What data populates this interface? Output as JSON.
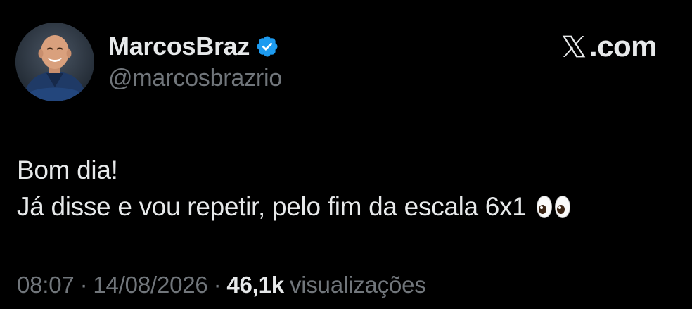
{
  "author": {
    "display_name": "MarcosBraz",
    "handle": "@marcosbrazrio",
    "verified": true,
    "verified_color": "#1d9bf0",
    "avatar_icon": "profile-photo"
  },
  "brand": {
    "icon": "x-logo-icon",
    "text": ".com"
  },
  "tweet": {
    "lines": [
      "Bom dia!",
      "Já disse e vou repetir, pelo fim da escala 6x1"
    ],
    "emoji": "eyes"
  },
  "meta": {
    "time": "08:07",
    "separator": "·",
    "date": "14/08/2026",
    "views_count": "46,1k",
    "views_label": "visualizações"
  },
  "colors": {
    "background": "#000000",
    "text_primary": "#e7e9ea",
    "text_secondary": "#71767b"
  }
}
